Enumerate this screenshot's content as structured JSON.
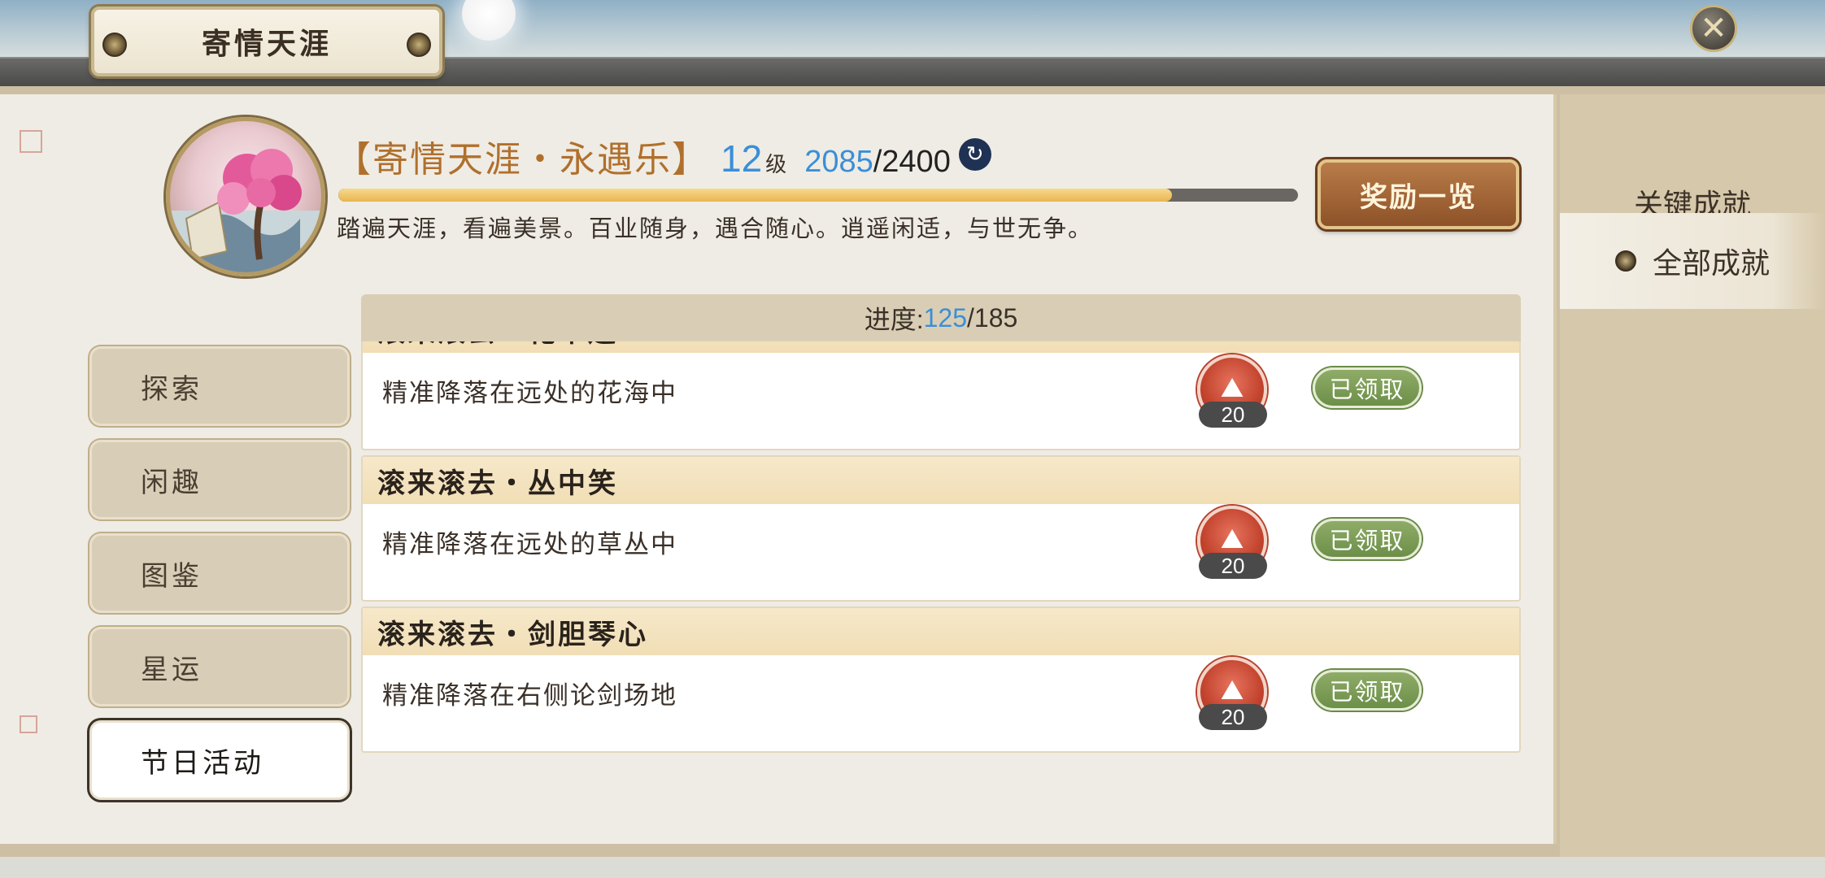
{
  "window": {
    "title": "寄情天涯",
    "close_icon": "close-icon"
  },
  "header": {
    "name": "【寄情天涯・永遇乐】",
    "level": "12",
    "level_unit": "级",
    "xp_current": "2085",
    "xp_max": "/2400",
    "xp_progress": 0.869,
    "description": "踏遍天涯，看遍美景。百业随身，遇合随心。逍遥闲适，与世无争。",
    "reward_button": "奖励一览"
  },
  "right_tabs": [
    {
      "label": "关键成就"
    },
    {
      "label": "全部成就"
    }
  ],
  "left_tabs": [
    {
      "label": "探索"
    },
    {
      "label": "闲趣"
    },
    {
      "label": "图鉴"
    },
    {
      "label": "星运"
    },
    {
      "label": "节日活动"
    }
  ],
  "progress": {
    "label": "进度:",
    "current": "125",
    "total": "/185"
  },
  "achievements": [
    {
      "title": "滚来滚去・花中迷",
      "desc": "精准降落在远处的花海中",
      "reward_count": "20",
      "status": "已领取"
    },
    {
      "title": "滚来滚去・丛中笑",
      "desc": "精准降落在远处的草丛中",
      "reward_count": "20",
      "status": "已领取"
    },
    {
      "title": "滚来滚去・剑胆琴心",
      "desc": "精准降落在右侧论剑场地",
      "reward_count": "20",
      "status": "已领取"
    }
  ],
  "colors": {
    "accent_blue": "#3a8fd8",
    "title_orange": "#b0702c",
    "claimed_green": "#7a9c55",
    "reward_red": "#c2432d"
  }
}
